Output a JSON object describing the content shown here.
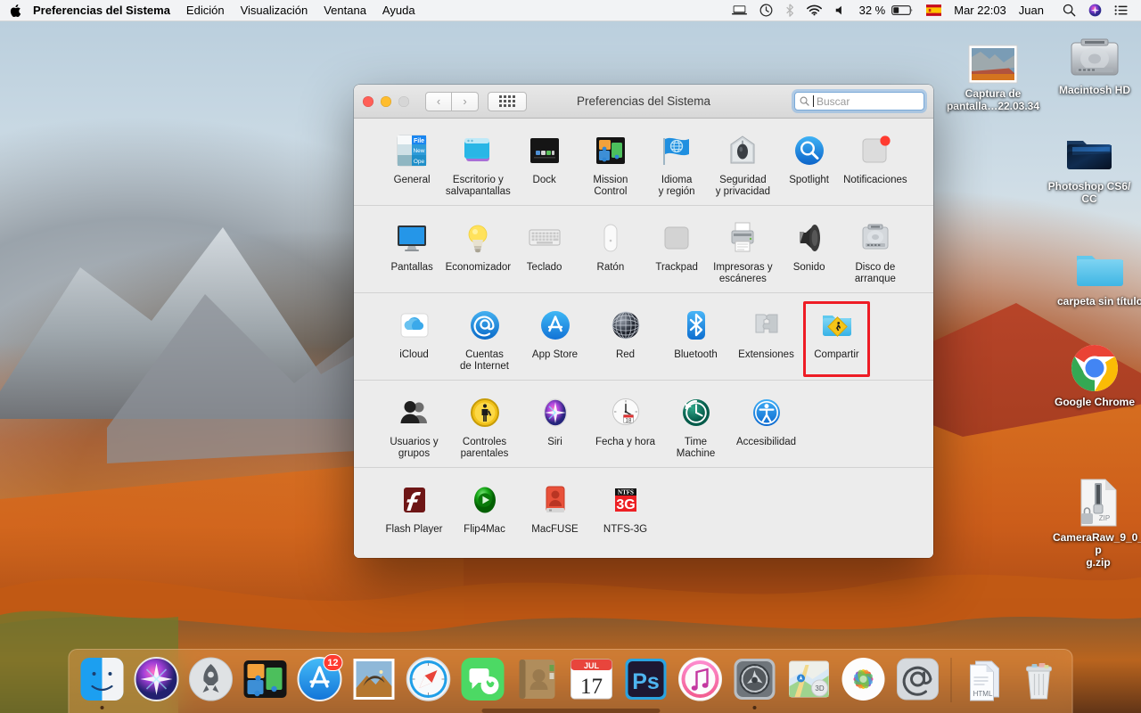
{
  "menubar": {
    "apple_icon": "apple-logo-icon",
    "app_name": "Preferencias del Sistema",
    "menus": [
      "Edición",
      "Visualización",
      "Ventana",
      "Ayuda"
    ],
    "status_icons": [
      "display-icon",
      "time-machine-icon",
      "bluetooth-icon",
      "wifi-icon",
      "volume-icon"
    ],
    "battery_percent": "32 %",
    "battery_icon": "battery-icon",
    "flag": "spanish-flag-icon",
    "datetime": "Mar 22:03",
    "user": "Juan",
    "right_icons": [
      "spotlight-search-icon",
      "siri-icon",
      "notification-center-icon"
    ]
  },
  "desktop": {
    "icons": [
      {
        "name": "Captura de\npantalla…22.03.34",
        "label_line1": "Captura de",
        "label_line2": "pantalla…22.03.34",
        "type": "screenshot-thumbnail"
      },
      {
        "name": "Macintosh HD",
        "label_line1": "Macintosh HD",
        "label_line2": "",
        "type": "hard-disk"
      },
      {
        "name": "Photoshop CS6/CC",
        "label_line1": "Photoshop CS6/",
        "label_line2": "CC",
        "type": "dark-folder"
      },
      {
        "name": "carpeta sin título",
        "label_line1": "carpeta sin título",
        "label_line2": "",
        "type": "blue-folder"
      },
      {
        "name": "Google Chrome",
        "label_line1": "Google Chrome",
        "label_line2": "",
        "type": "chrome-app"
      },
      {
        "name": "CameraRaw_9_0_.pkg.zip",
        "label_line1": "CameraRaw_9_0_p",
        "label_line2": "g.zip",
        "type": "zip-archive"
      }
    ]
  },
  "window": {
    "title": "Preferencias del Sistema",
    "traffic_lights": [
      "close-red",
      "minimize-yellow",
      "zoom-green-disabled"
    ],
    "nav_back": "‹",
    "nav_forward": "›",
    "grid_button": "show-all-grid-icon",
    "search": {
      "placeholder": "Buscar",
      "value": "",
      "focused": true
    },
    "rows": [
      {
        "items": [
          {
            "label_line1": "General",
            "label_line2": "",
            "icon": "general-icon"
          },
          {
            "label_line1": "Escritorio y",
            "label_line2": "salvapantallas",
            "icon": "desktop-screensaver-icon"
          },
          {
            "label_line1": "Dock",
            "label_line2": "",
            "icon": "dock-icon"
          },
          {
            "label_line1": "Mission",
            "label_line2": "Control",
            "icon": "mission-control-icon"
          },
          {
            "label_line1": "Idioma",
            "label_line2": "y región",
            "icon": "language-region-icon"
          },
          {
            "label_line1": "Seguridad",
            "label_line2": "y privacidad",
            "icon": "security-privacy-icon"
          },
          {
            "label_line1": "Spotlight",
            "label_line2": "",
            "icon": "spotlight-icon"
          },
          {
            "label_line1": "Notificaciones",
            "label_line2": "",
            "icon": "notifications-icon"
          }
        ]
      },
      {
        "items": [
          {
            "label_line1": "Pantallas",
            "label_line2": "",
            "icon": "displays-icon"
          },
          {
            "label_line1": "Economizador",
            "label_line2": "",
            "icon": "energy-saver-icon"
          },
          {
            "label_line1": "Teclado",
            "label_line2": "",
            "icon": "keyboard-icon"
          },
          {
            "label_line1": "Ratón",
            "label_line2": "",
            "icon": "mouse-icon"
          },
          {
            "label_line1": "Trackpad",
            "label_line2": "",
            "icon": "trackpad-icon"
          },
          {
            "label_line1": "Impresoras y",
            "label_line2": "escáneres",
            "icon": "printers-scanners-icon"
          },
          {
            "label_line1": "Sonido",
            "label_line2": "",
            "icon": "sound-icon"
          },
          {
            "label_line1": "Disco de",
            "label_line2": "arranque",
            "icon": "startup-disk-icon"
          }
        ]
      },
      {
        "items": [
          {
            "label_line1": "iCloud",
            "label_line2": "",
            "icon": "icloud-icon"
          },
          {
            "label_line1": "Cuentas",
            "label_line2": "de Internet",
            "icon": "internet-accounts-icon"
          },
          {
            "label_line1": "App Store",
            "label_line2": "",
            "icon": "app-store-icon"
          },
          {
            "label_line1": "Red",
            "label_line2": "",
            "icon": "network-icon"
          },
          {
            "label_line1": "Bluetooth",
            "label_line2": "",
            "icon": "bluetooth-icon"
          },
          {
            "label_line1": "Extensiones",
            "label_line2": "",
            "icon": "extensions-icon"
          },
          {
            "label_line1": "Compartir",
            "label_line2": "",
            "icon": "sharing-icon",
            "highlighted": true
          }
        ]
      },
      {
        "items": [
          {
            "label_line1": "Usuarios y",
            "label_line2": "grupos",
            "icon": "users-groups-icon"
          },
          {
            "label_line1": "Controles",
            "label_line2": "parentales",
            "icon": "parental-controls-icon"
          },
          {
            "label_line1": "Siri",
            "label_line2": "",
            "icon": "siri-icon"
          },
          {
            "label_line1": "Fecha y hora",
            "label_line2": "",
            "icon": "date-time-icon"
          },
          {
            "label_line1": "Time",
            "label_line2": "Machine",
            "icon": "time-machine-icon"
          },
          {
            "label_line1": "Accesibilidad",
            "label_line2": "",
            "icon": "accessibility-icon"
          }
        ]
      },
      {
        "items": [
          {
            "label_line1": "Flash Player",
            "label_line2": "",
            "icon": "flash-player-icon"
          },
          {
            "label_line1": "Flip4Mac",
            "label_line2": "",
            "icon": "flip4mac-icon"
          },
          {
            "label_line1": "MacFUSE",
            "label_line2": "",
            "icon": "macfuse-icon"
          },
          {
            "label_line1": "NTFS-3G",
            "label_line2": "",
            "icon": "ntfs-3g-icon"
          }
        ]
      }
    ]
  },
  "dock": {
    "items": [
      {
        "name": "Finder",
        "icon": "finder-icon",
        "running": true
      },
      {
        "name": "Siri",
        "icon": "siri-icon",
        "running": false
      },
      {
        "name": "Launchpad",
        "icon": "launchpad-icon",
        "running": false
      },
      {
        "name": "Mission Control",
        "icon": "mission-control-icon",
        "running": false
      },
      {
        "name": "App Store",
        "icon": "app-store-icon",
        "running": false,
        "badge": "12"
      },
      {
        "name": "Mail",
        "icon": "mail-stamp-icon",
        "running": false
      },
      {
        "name": "Safari",
        "icon": "safari-icon",
        "running": false
      },
      {
        "name": "Mensajes",
        "icon": "messages-icon",
        "running": false
      },
      {
        "name": "Contactos",
        "icon": "contacts-icon",
        "running": false
      },
      {
        "name": "Calendario",
        "icon": "calendar-icon",
        "running": false,
        "cal_month": "JUL",
        "cal_day": "17"
      },
      {
        "name": "Photoshop",
        "icon": "photoshop-icon",
        "running": false
      },
      {
        "name": "iTunes",
        "icon": "itunes-icon",
        "running": false
      },
      {
        "name": "Preferencias del Sistema",
        "icon": "system-preferences-icon",
        "running": true
      },
      {
        "name": "Mapas",
        "icon": "maps-icon",
        "running": false
      },
      {
        "name": "Fotos",
        "icon": "photos-icon",
        "running": false
      },
      {
        "name": "Mail",
        "icon": "at-sign-icon",
        "running": false
      }
    ],
    "stack": {
      "name": "Documentos",
      "icon": "html-document-stack-icon",
      "label": "HTML"
    },
    "trash": {
      "name": "Papelera",
      "icon": "trash-icon"
    }
  },
  "colors": {
    "accent_red": "#ee1c25",
    "badge_red": "#ff3b30",
    "focus_blue": "#7aa9d8",
    "window_bg": "#ececec",
    "menubar_bg": "#f6f6f6"
  }
}
